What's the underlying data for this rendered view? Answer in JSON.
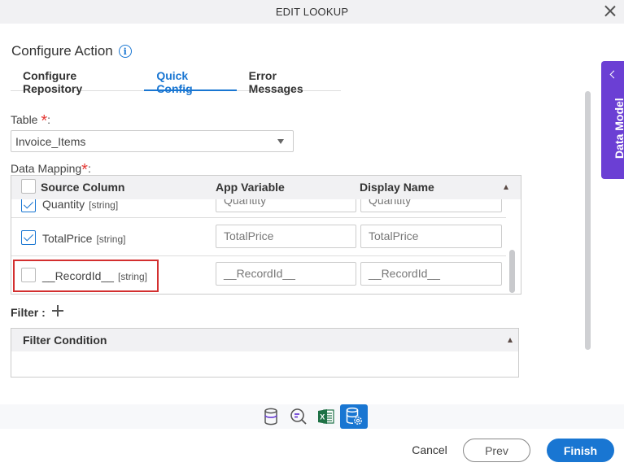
{
  "dialog": {
    "title": "EDIT LOOKUP",
    "close_label": "Close"
  },
  "header": {
    "title": "Configure Action"
  },
  "tabs": [
    {
      "label": "Configure Repository",
      "active": false
    },
    {
      "label": "Quick Config",
      "active": true
    },
    {
      "label": "Error Messages",
      "active": false
    }
  ],
  "table_field": {
    "label": "Table",
    "required_mark": "*",
    "suffix": ":",
    "value": "Invoice_Items"
  },
  "data_mapping": {
    "label": "Data Mapping",
    "required_mark": "*",
    "suffix": ":",
    "columns": [
      "Source Column",
      "App Variable",
      "Display Name"
    ],
    "rows": [
      {
        "name": "Quantity",
        "type": "[string]",
        "checked": true,
        "app_variable": "Quantity",
        "display_name": "Quantity"
      },
      {
        "name": "TotalPrice",
        "type": "[string]",
        "checked": true,
        "app_variable": "TotalPrice",
        "display_name": "TotalPrice"
      },
      {
        "name": "__RecordId__",
        "type": "[string]",
        "checked": false,
        "app_variable": "__RecordId__",
        "display_name": "__RecordId__",
        "highlighted": true
      }
    ]
  },
  "filter": {
    "label": "Filter :",
    "column": "Filter Condition"
  },
  "side_panel": {
    "label": "Data Model",
    "accent": "#6b3fd4"
  },
  "icon_bar": [
    {
      "icon": "database-icon",
      "active": false
    },
    {
      "icon": "query-search-icon",
      "active": false
    },
    {
      "icon": "excel-icon",
      "active": false
    },
    {
      "icon": "database-settings-icon",
      "active": true
    }
  ],
  "footer": {
    "cancel": "Cancel",
    "prev": "Prev",
    "finish": "Finish"
  },
  "colors": {
    "primary": "#1976d2",
    "required": "#e53935",
    "highlight_border": "#d32f2f"
  }
}
